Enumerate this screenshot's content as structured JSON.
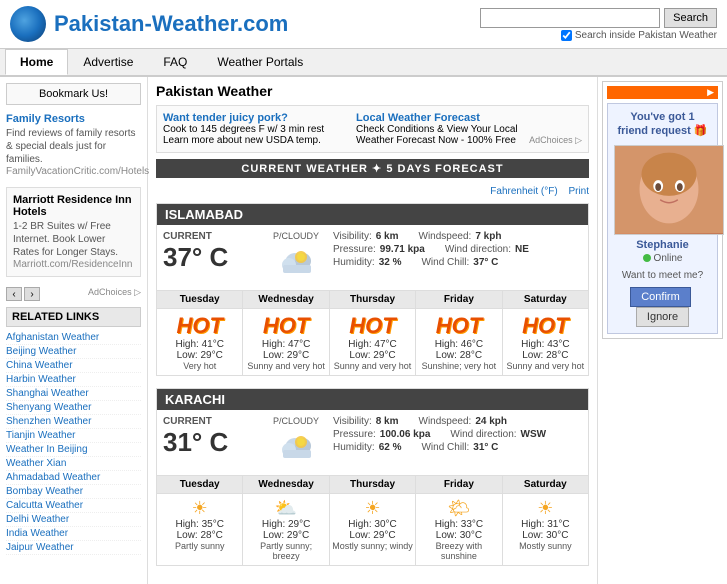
{
  "site": {
    "title": "Pakistan-Weather.com",
    "logo_alt": "globe icon"
  },
  "header": {
    "search_placeholder": "",
    "search_btn": "Search",
    "search_option_label": "Search inside Pakistan Weather"
  },
  "nav": {
    "items": [
      {
        "label": "Home",
        "active": true
      },
      {
        "label": "Advertise",
        "active": false
      },
      {
        "label": "FAQ",
        "active": false
      },
      {
        "label": "Weather Portals",
        "active": false
      }
    ]
  },
  "sidebar_left": {
    "bookmark_btn": "Bookmark Us!",
    "family_resorts": {
      "title": "Family Resorts",
      "text": "Find reviews of family resorts & special deals just for families.",
      "link": "FamilyVacationCritic.com/Hotels"
    },
    "marriott": {
      "title": "Marriott Residence Inn Hotels",
      "text": "1-2 BR Suites w/ Free Internet. Book Lower Rates for Longer Stays.",
      "link": "Marriott.com/ResidenceInn"
    },
    "ad_choices": "AdChoices ▷",
    "related_links_title": "RELATED LINKS",
    "links": [
      "Afghanistan Weather",
      "Beijing Weather",
      "China Weather",
      "Harbin Weather",
      "Shanghai Weather",
      "Shenyang Weather",
      "Shenzhen Weather",
      "Tianjin Weather",
      "Weather In Beijing",
      "Weather Xian",
      "Ahmadabad Weather",
      "Bombay Weather",
      "Calcutta Weather",
      "Delhi Weather",
      "India Weather",
      "Jaipur Weather"
    ]
  },
  "page": {
    "title": "Pakistan Weather",
    "ad_left_title": "Want tender juicy pork?",
    "ad_left_text": "Cook to 145 degrees F w/ 3 min rest Learn more about new USDA temp.",
    "ad_right_title": "Local Weather Forecast",
    "ad_right_text": "Check Conditions & View Your Local Weather Forecast Now - 100% Free",
    "ad_choices": "AdChoices ▷",
    "weather_bar": "CURRENT WEATHER ✦ 5 DAYS FORECAST",
    "fahrenheit_link": "Fahrenheit (°F)",
    "print_link": "Print"
  },
  "islamabad": {
    "city": "ISLAMABAD",
    "current_label": "CURRENT",
    "current_temp": "37° C",
    "condition": "P/CLOUDY",
    "visibility_label": "Visibility:",
    "visibility": "6 km",
    "windspeed_label": "Windspeed:",
    "windspeed": "7 kph",
    "pressure_label": "Pressure:",
    "pressure": "99.71 kpa",
    "wind_direction_label": "Wind direction:",
    "wind_direction": "NE",
    "humidity_label": "Humidity:",
    "humidity": "32 %",
    "wind_chill_label": "Wind Chill:",
    "wind_chill": "37° C",
    "forecast": [
      {
        "day": "Tuesday",
        "icon": "hot",
        "high": "41°C",
        "low": "29°C",
        "desc": "Very hot"
      },
      {
        "day": "Wednesday",
        "icon": "hot",
        "high": "47°C",
        "low": "29°C",
        "desc": "Sunny and very hot"
      },
      {
        "day": "Thursday",
        "icon": "hot",
        "high": "47°C",
        "low": "29°C",
        "desc": "Sunny and very hot"
      },
      {
        "day": "Friday",
        "icon": "hot",
        "high": "46°C",
        "low": "28°C",
        "desc": "Sunshine; very hot"
      },
      {
        "day": "Saturday",
        "icon": "hot",
        "high": "43°C",
        "low": "28°C",
        "desc": "Sunny and very hot"
      }
    ]
  },
  "karachi": {
    "city": "KARACHI",
    "current_label": "CURRENT",
    "current_temp": "31° C",
    "condition": "P/CLOUDY",
    "visibility_label": "Visibility:",
    "visibility": "8 km",
    "windspeed_label": "Windspeed:",
    "windspeed": "24 kph",
    "pressure_label": "Pressure:",
    "pressure": "100.06 kpa",
    "wind_direction_label": "Wind direction:",
    "wind_direction": "WSW",
    "humidity_label": "Humidity:",
    "humidity": "62 %",
    "wind_chill_label": "Wind Chill:",
    "wind_chill": "31° C",
    "forecast": [
      {
        "day": "Tuesday",
        "icon": "sun",
        "high": "35°C",
        "low": "28°C",
        "desc": "Partly sunny"
      },
      {
        "day": "Wednesday",
        "icon": "sun",
        "high": "29°C",
        "low": "29°C",
        "desc": "Partly sunny; breezy"
      },
      {
        "day": "Thursday",
        "icon": "sun",
        "high": "30°C",
        "low": "29°C",
        "desc": "Mostly sunny; windy"
      },
      {
        "day": "Friday",
        "icon": "sun",
        "high": "33°C",
        "low": "30°C",
        "desc": "Breezy with sunshine"
      },
      {
        "day": "Saturday",
        "icon": "sun",
        "high": "31°C",
        "low": "30°C",
        "desc": "Mostly sunny"
      }
    ]
  },
  "right_ad": {
    "badge": "▶",
    "friend_text": "You've got 1 friend request 🎁",
    "friend_name": "Stephanie",
    "online_label": "Online",
    "meet_text": "Want to meet me?",
    "confirm_btn": "Confirm",
    "ignore_btn": "Ignore"
  }
}
